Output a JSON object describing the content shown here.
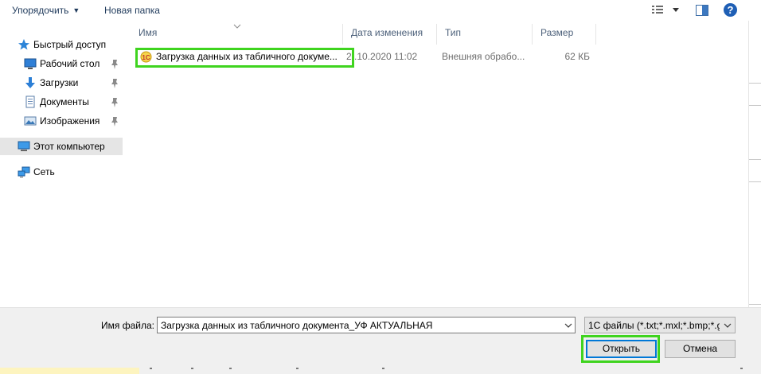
{
  "toolbar": {
    "organize_label": "Упорядочить",
    "new_folder_label": "Новая папка"
  },
  "nav": {
    "items": [
      {
        "label": "Быстрый доступ",
        "icon": "star-icon"
      },
      {
        "label": "Рабочий стол",
        "icon": "desktop-icon",
        "pinned": true
      },
      {
        "label": "Загрузки",
        "icon": "download-icon",
        "pinned": true
      },
      {
        "label": "Документы",
        "icon": "documents-icon",
        "pinned": true
      },
      {
        "label": "Изображения",
        "icon": "pictures-icon",
        "pinned": true
      },
      {
        "label": "Этот компьютер",
        "icon": "computer-icon",
        "selected": true
      },
      {
        "label": "Сеть",
        "icon": "network-icon"
      }
    ]
  },
  "list": {
    "columns": [
      "Имя",
      "Дата изменения",
      "Тип",
      "Размер"
    ],
    "files": [
      {
        "name": "Загрузка данных из табличного докуме...",
        "date": "2..10.2020 11:02",
        "type": "Внешняя обрабо...",
        "size": "62 КБ"
      }
    ]
  },
  "bottom": {
    "file_name_label": "Имя файла:",
    "file_name_value": "Загрузка данных из табличного документа_УФ АКТУАЛЬНАЯ",
    "filter_value": "1С файлы (*.txt;*.mxl;*.bmp;*.g",
    "open_label": "Открыть",
    "cancel_label": "Отмена"
  },
  "colors": {
    "highlight": "#3fd41f",
    "accent": "#0078d7",
    "selected_bg": "#e5e5e5"
  }
}
